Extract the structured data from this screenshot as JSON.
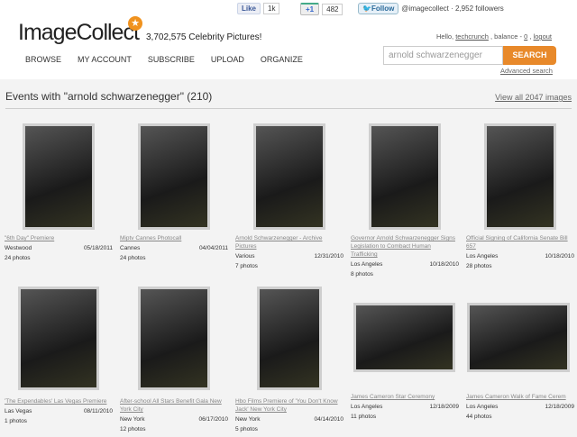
{
  "social": {
    "fb_label": "Like",
    "fb_count": "1k",
    "gplus_label": "+1",
    "gplus_count": "482",
    "twitter_label": "Follow",
    "twitter_text": "@imagecollect · 2,952 followers"
  },
  "header": {
    "logo": "ImageCollect",
    "tagline": "3,702,575 Celebrity Pictures!",
    "hello": "Hello,",
    "username": "techcrunch",
    "balance_label": ", balance -",
    "balance": "0",
    "logout": "logout"
  },
  "nav": [
    "BROWSE",
    "MY ACCOUNT",
    "SUBSCRIBE",
    "UPLOAD",
    "ORGANIZE"
  ],
  "search": {
    "value": "arnold schwarzenegger",
    "button": "SEARCH",
    "advanced": "Advanced search"
  },
  "main": {
    "title": "Events with \"arnold schwarzenegger\" (210)",
    "view_all": "View all 2047 images"
  },
  "events": [
    {
      "title": "\"6th Day\" Premiere",
      "location": "Westwood",
      "date": "05/18/2011",
      "photos": "24 photos"
    },
    {
      "title": "Miptv Cannes Photocall",
      "location": "Cannes",
      "date": "04/04/2011",
      "photos": "24 photos"
    },
    {
      "title": "Arnold Schwarzenegger - Archive Pictures",
      "location": "Various",
      "date": "12/31/2010",
      "photos": "7 photos"
    },
    {
      "title": "Governor Arnold Schwarzenegger Signs Legislation to Combact Human Trafficking",
      "location": "Los Angeles",
      "date": "10/18/2010",
      "photos": "8 photos"
    },
    {
      "title": "Official Signing of California Senate Bill 657",
      "location": "Los Angeles",
      "date": "10/18/2010",
      "photos": "28 photos"
    },
    {
      "title": "'The Expendables' Las Vegas Premiere",
      "location": "Las Vegas",
      "date": "08/11/2010",
      "photos": "1 photos"
    },
    {
      "title": "After-school All Stars Benefit Gala New York City",
      "location": "New York",
      "date": "06/17/2010",
      "photos": "12 photos"
    },
    {
      "title": "Hbo Films Premiere of 'You Don't Know Jack' New York City",
      "location": "New York",
      "date": "04/14/2010",
      "photos": "5 photos"
    },
    {
      "title": "James Cameron Star Ceremony",
      "location": "Los Angeles",
      "date": "12/18/2009",
      "photos": "11 photos"
    },
    {
      "title": "James Cameron Walk of Fame Cerem",
      "location": "Los Angeles",
      "date": "12/18/2009",
      "photos": "44 photos"
    }
  ]
}
